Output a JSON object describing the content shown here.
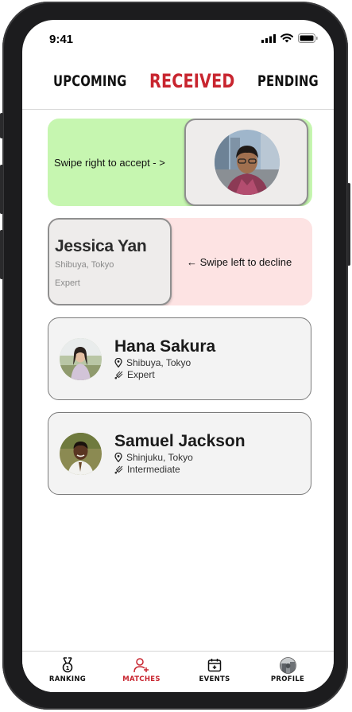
{
  "status_bar": {
    "time": "9:41",
    "icons": [
      "signal-icon",
      "wifi-icon",
      "battery-icon"
    ]
  },
  "tabs": [
    {
      "label": "UPCOMING",
      "active": false
    },
    {
      "label": "RECEIVED",
      "active": true
    },
    {
      "label": "PENDING",
      "active": false
    }
  ],
  "requests": {
    "accept_hint": "Swipe right to accept - >",
    "decline_hint": "← Swipe left to decline",
    "decline_card": {
      "name": "Jessica Yan",
      "location": "Shibuya, Tokyo",
      "level": "Expert"
    }
  },
  "matches": [
    {
      "name": "Hana Sakura",
      "location": "Shibuya, Tokyo",
      "level": "Expert"
    },
    {
      "name": "Samuel Jackson",
      "location": "Shinjuku, Tokyo",
      "level": "Intermediate"
    }
  ],
  "bottom_nav": [
    {
      "label": "RANKING",
      "icon": "medal-icon",
      "active": false
    },
    {
      "label": "MATCHES",
      "icon": "add-user-icon",
      "active": true
    },
    {
      "label": "EVENTS",
      "icon": "calendar-add-icon",
      "active": false
    },
    {
      "label": "PROFILE",
      "icon": "profile-avatar",
      "active": false
    }
  ],
  "colors": {
    "accent": "#c8252f",
    "accept_bg": "#c6f6b0",
    "decline_bg": "#fde3e3",
    "card_bg": "#f3f3f3"
  }
}
